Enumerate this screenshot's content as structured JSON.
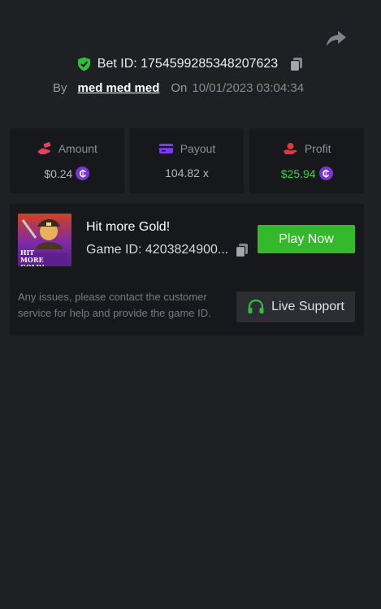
{
  "header": {
    "bet_id_label": "Bet ID: 1754599285348207623",
    "by_label": "By",
    "username": "med med med",
    "on_label": "On",
    "date": "10/01/2023 03:04:34"
  },
  "stats": [
    {
      "label": "Amount",
      "value": "$0.24",
      "icon": "bet-hand-icon",
      "coin": true
    },
    {
      "label": "Payout",
      "value": "104.82 x",
      "icon": "wallet-card-icon",
      "coin": false
    },
    {
      "label": "Profit",
      "value": "$25.94",
      "icon": "profit-hand-icon",
      "coin": true
    }
  ],
  "game": {
    "title": "Hit more Gold!",
    "id_label": "Game ID: 4203824900...",
    "thumb_text": "HIT MORE GOLD!",
    "play_label": "Play Now"
  },
  "support": {
    "text": "Any issues, please contact the customer service for help and provide the game ID.",
    "button_label": "Live Support"
  },
  "coin_symbol": "₵",
  "colors": {
    "background": "#1f2024",
    "card": "#17181b",
    "green": "#35b92c",
    "profit_green": "#3fd13f",
    "coin_purple": "#7b32d9",
    "amount_icon": "#e8415f",
    "payout_icon": "#7b3cf0",
    "profit_icon": "#e0373b"
  }
}
